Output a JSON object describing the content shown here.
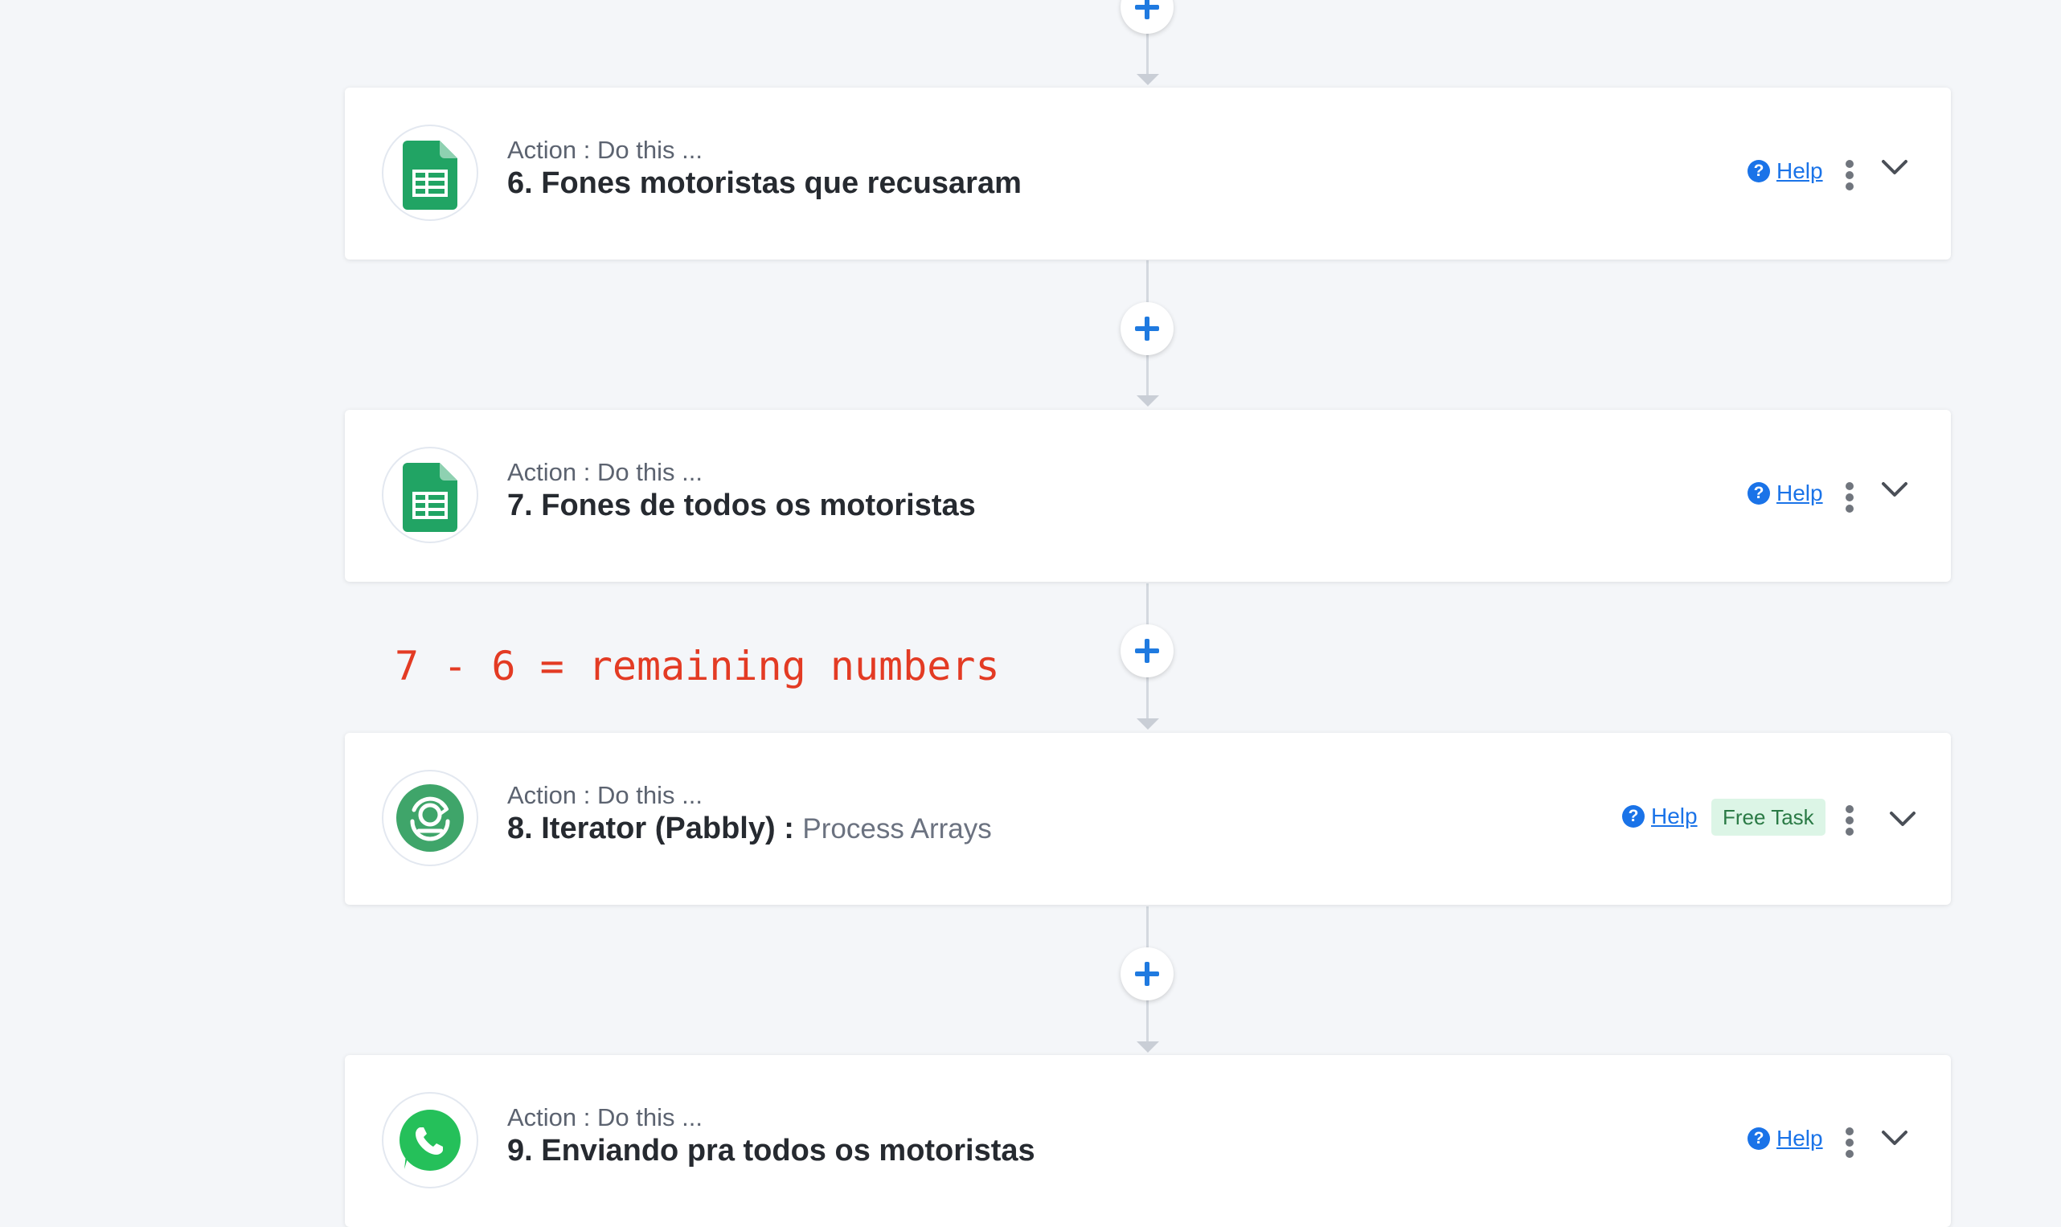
{
  "steps": [
    {
      "subtitle": "Action : Do this ...",
      "title": "6. Fones motoristas que recusaram",
      "detail": "",
      "icon": "google-sheets-icon",
      "help_label": "Help"
    },
    {
      "subtitle": "Action : Do this ...",
      "title": "7. Fones de todos os motoristas",
      "detail": "",
      "icon": "google-sheets-icon",
      "help_label": "Help"
    },
    {
      "subtitle": "Action : Do this ...",
      "title": "8. Iterator (Pabbly) :",
      "detail": "Process Arrays",
      "icon": "iterator-icon",
      "help_label": "Help",
      "badge": "Free Task"
    },
    {
      "subtitle": "Action : Do this ...",
      "title": "9. Enviando pra todos os motoristas",
      "detail": "",
      "icon": "whatsapp-icon",
      "help_label": "Help"
    }
  ],
  "annotation": "7 - 6 = remaining numbers",
  "colors": {
    "background": "#f4f6f9",
    "accent": "#1a73e8",
    "sheets_green": "#21a464",
    "annotation_red": "#e33b24",
    "badge_bg": "#dcf5e6"
  }
}
